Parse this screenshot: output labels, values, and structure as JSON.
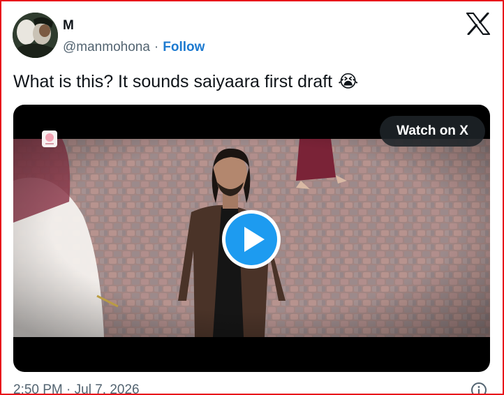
{
  "tweet": {
    "author_name": "M",
    "handle": "@manmohona",
    "separator": "·",
    "follow_label": "Follow",
    "text": "What is this? It sounds saiyaara first draft",
    "emoji": "😭",
    "timestamp": "2:50 PM · Jul 7, 2026"
  },
  "video": {
    "watch_label": "Watch on X"
  },
  "icons": {
    "brand": "x-logo-icon",
    "play": "play-icon",
    "info": "info-icon"
  },
  "colors": {
    "border": "#e8141b",
    "follow": "#1d7ad0",
    "play_button": "#1d9bf0",
    "text_primary": "#0f1419",
    "text_secondary": "#536471"
  }
}
